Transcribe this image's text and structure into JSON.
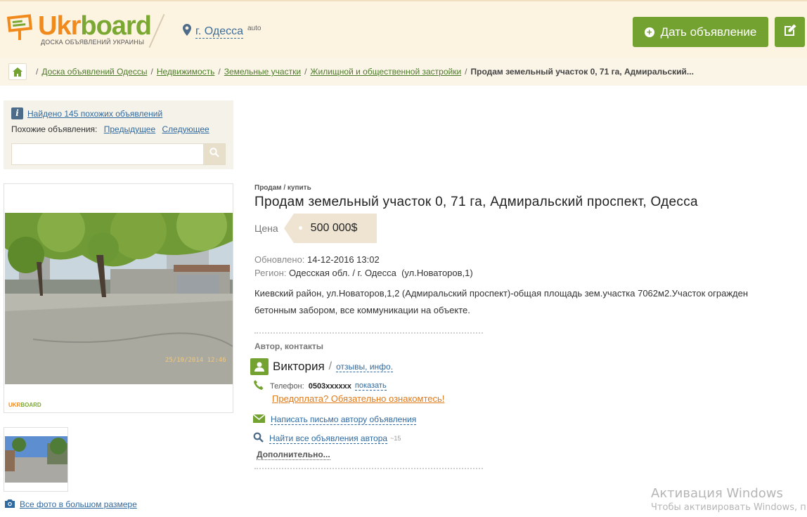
{
  "header": {
    "logo_ukr": "Ukr",
    "logo_board": "board",
    "logo_tagline": "ДОСКА ОБЪЯВЛЕНИЙ УКРАИНЫ",
    "city": "г. Одесса",
    "city_suffix": "auto",
    "post_button": "Дать объявление",
    "accent_color": "#74a231",
    "brand_orange": "#f08a1c"
  },
  "breadcrumbs": {
    "items": [
      "Доска объявлений Одессы",
      "Недвижимость",
      "Земельные участки",
      "Жилищной и общественной застройки"
    ],
    "current": "Продам земельный участок 0, 71 га, Адмиральский..."
  },
  "sidebar": {
    "found_text": "Найдено 145 похожих объявлений",
    "similar_label": "Похожие объявления:",
    "prev": "Предыдущее",
    "next": "Следующее",
    "search_value": "",
    "photo_watermark": "UKRBOARD",
    "all_photos": "Все фото в большом размере"
  },
  "ad": {
    "category": "Продам / купить",
    "title": "Продам земельный участок 0, 71 га, Адмиральский проспект, Одесса",
    "price_label": "Цена",
    "price": "500 000$",
    "updated_label": "Обновлено:",
    "updated": "14-12-2016 13:02",
    "region_label": "Регион:",
    "region": "Одесская обл. / г. Одесса  (ул.Новаторов,1)",
    "description": "Киевский район, ул.Новаторов,1,2 (Адмиральский проспект)-общая площадь зем.участка 7062м2.Участок огражден бетонным забором, все коммуникации на объекте."
  },
  "contacts": {
    "heading": "Автор, контакты",
    "author": "Виктория",
    "author_link": "отзывы, инфо.",
    "phone_label": "Телефон:",
    "phone": "0503xxxxxx",
    "show_phone": "показать",
    "warning": "Предоплата? Обязательно ознакомтесь!",
    "write_link": "Написать письмо автору объявления",
    "find_link": "Найти все объявления автора",
    "find_count": "~15",
    "more": "Дополнительно..."
  },
  "os_overlay": {
    "line1": "Активация Windows",
    "line2": "Чтобы активировать Windows, п"
  }
}
